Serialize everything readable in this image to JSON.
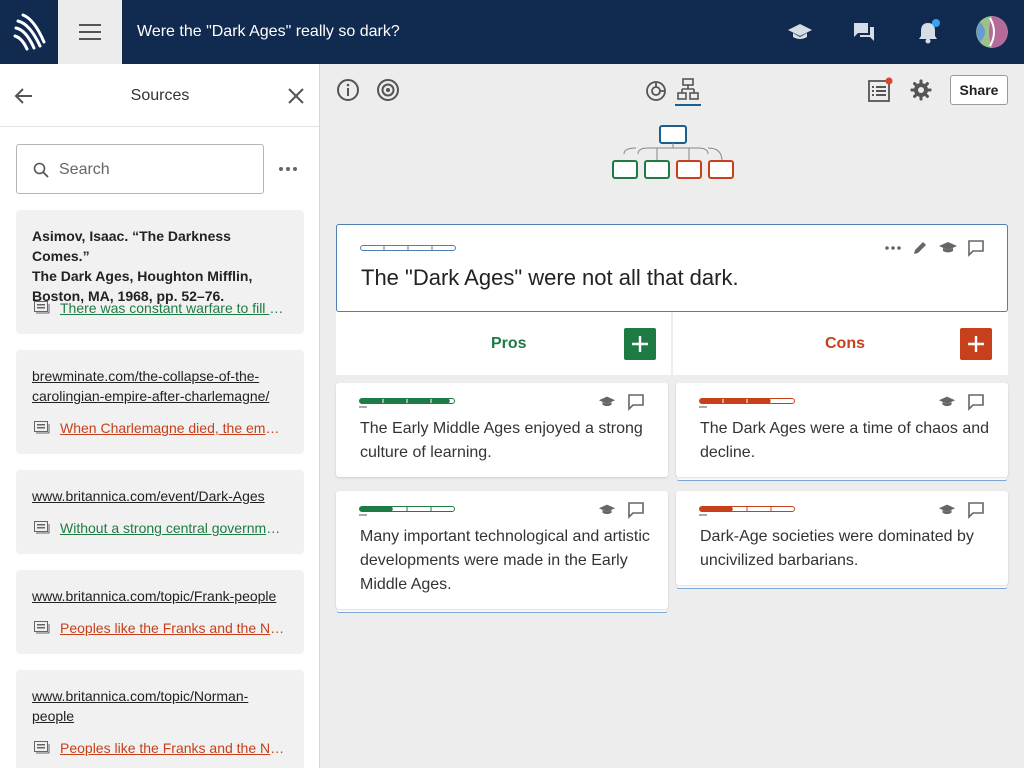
{
  "header": {
    "title": "Were the \"Dark Ages\" really so dark?",
    "icons": [
      "logo-icon",
      "menu-icon",
      "graduation-cap-icon",
      "chat-icon",
      "bell-icon",
      "avatar"
    ],
    "colors": {
      "bar": "#112a4f",
      "notification_dot": "#3aa0f0"
    }
  },
  "sidebar": {
    "title": "Sources",
    "search_placeholder": "Search",
    "sources": [
      {
        "source_lines": [
          "Asimov, Isaac. “The Darkness Comes.”",
          "The Dark Ages, Houghton Mifflin,",
          "Boston, MA, 1968, pp. 52–76."
        ],
        "style": "bold",
        "claim": "There was constant warfare to fill the power vacuum.",
        "claim_type": "pro"
      },
      {
        "source_lines": [
          "brewminate.com/the-collapse-of-the-",
          "carolingian-empire-after-charlemagne/"
        ],
        "style": "link",
        "claim": "When Charlemagne died, the empire fell apart.",
        "claim_type": "con"
      },
      {
        "source_lines": [
          "www.britannica.com/event/Dark-Ages"
        ],
        "style": "link",
        "claim": "Without a strong central government, order collapsed.",
        "claim_type": "pro"
      },
      {
        "source_lines": [
          "www.britannica.com/topic/Frank-people"
        ],
        "style": "link",
        "claim": "Peoples like the Franks and the Normans raided.",
        "claim_type": "con"
      },
      {
        "source_lines": [
          "www.britannica.com/topic/Norman-",
          "people"
        ],
        "style": "link",
        "claim": "Peoples like the Franks and the Normans raided.",
        "claim_type": "con"
      }
    ]
  },
  "toolbar": {
    "share_label": "Share",
    "icons": [
      "info-icon",
      "eye-icon",
      "sunburst-icon",
      "tree-icon",
      "list-icon",
      "gear-icon"
    ]
  },
  "main_claim": {
    "text": "The \"Dark Ages\" were not all that dark."
  },
  "pros": {
    "label": "Pros",
    "color": "#1e7b43",
    "items": [
      {
        "text": "The Early Middle Ages enjoyed a strong culture of learning.",
        "score": 0.95
      },
      {
        "text": "Many important technological and artistic developments were made in the Early Middle Ages.",
        "score": 0.35
      }
    ]
  },
  "cons": {
    "label": "Cons",
    "color": "#c7401b",
    "items": [
      {
        "text": "The Dark Ages were a time of chaos and decline.",
        "score": 0.75
      },
      {
        "text": "Dark-Age societies were dominated by uncivilized barbarians.",
        "score": 0.35
      }
    ]
  }
}
